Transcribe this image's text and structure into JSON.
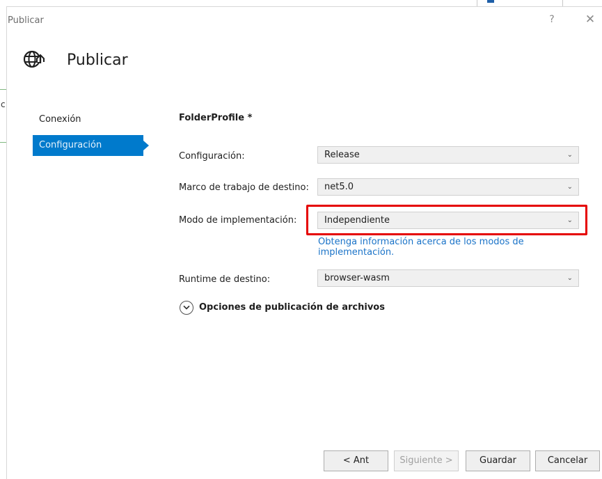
{
  "window": {
    "title": "Publicar",
    "help": "?",
    "close": "✕"
  },
  "header": {
    "title": "Publicar",
    "icon": "globe-publish-icon"
  },
  "nav": {
    "items": [
      {
        "label": "Conexión"
      },
      {
        "label": "Configuración",
        "active": true
      }
    ]
  },
  "profile": {
    "title": "FolderProfile *"
  },
  "fields": {
    "configuration": {
      "label": "Configuración:",
      "value": "Release"
    },
    "target_framework": {
      "label": "Marco de trabajo de destino:",
      "value": "net5.0"
    },
    "deployment_mode": {
      "label": "Modo de implementación:",
      "value": "Independiente"
    },
    "target_runtime": {
      "label": "Runtime de destino:",
      "value": "browser-wasm"
    }
  },
  "info_link": {
    "line1": "Obtenga información acerca de los modos de",
    "line2": "implementación."
  },
  "expander": {
    "label": "Opciones de publicación de archivos"
  },
  "footer": {
    "back": "< Ant",
    "next": "Siguiente >",
    "save": "Guardar",
    "cancel": "Cancelar"
  },
  "colors": {
    "accent": "#007acc",
    "highlight": "#e50000",
    "link": "#1a73c8"
  }
}
